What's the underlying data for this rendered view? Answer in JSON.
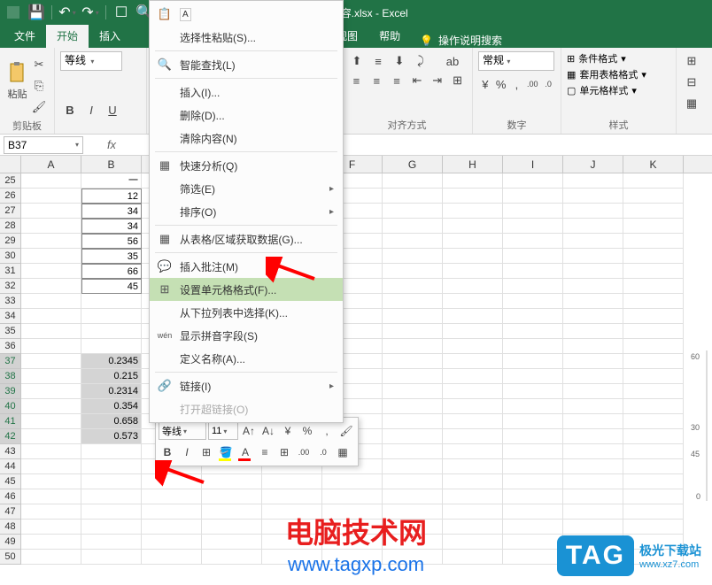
{
  "title": "Excel内容.xlsx - Excel",
  "tabs": {
    "file": "文件",
    "home": "开始",
    "insert": "插入",
    "view": "视图",
    "help": "帮助",
    "search": "操作说明搜索"
  },
  "ribbon": {
    "clipboard": {
      "paste": "粘贴",
      "label": "剪贴板"
    },
    "font": {
      "name": "等线",
      "bold": "B",
      "italic": "I",
      "underline": "U"
    },
    "align": {
      "label": "对齐方式"
    },
    "number": {
      "label": "数字",
      "general": "常规",
      "currency": "¥",
      "percent": "%",
      "comma": ",",
      "inc": ".00",
      "dec": ".0"
    },
    "styles": {
      "cond": "条件格式",
      "table": "套用表格格式",
      "cell": "单元格样式",
      "label": "样式"
    }
  },
  "namebox": "B37",
  "columns": [
    "A",
    "B",
    "",
    "",
    "",
    "F",
    "G",
    "H",
    "I",
    "J",
    "K"
  ],
  "rows": [
    {
      "n": 25,
      "b": "一"
    },
    {
      "n": 26,
      "b": "12",
      "bord": true
    },
    {
      "n": 27,
      "b": "34",
      "bord": true
    },
    {
      "n": 28,
      "b": "34",
      "bord": true
    },
    {
      "n": 29,
      "b": "56",
      "bord": true
    },
    {
      "n": 30,
      "b": "35",
      "bord": true
    },
    {
      "n": 31,
      "b": "66",
      "bord": true
    },
    {
      "n": 32,
      "b": "45",
      "bord": true
    },
    {
      "n": 33,
      "b": ""
    },
    {
      "n": 34,
      "b": ""
    },
    {
      "n": 35,
      "b": ""
    },
    {
      "n": 36,
      "b": ""
    },
    {
      "n": 37,
      "b": "0.2345",
      "sel": true
    },
    {
      "n": 38,
      "b": "0.215",
      "sel": true
    },
    {
      "n": 39,
      "b": "0.2314",
      "sel": true
    },
    {
      "n": 40,
      "b": "0.354",
      "sel": true
    },
    {
      "n": 41,
      "b": "0.658",
      "sel": true
    },
    {
      "n": 42,
      "b": "0.573",
      "sel": true
    },
    {
      "n": 43,
      "b": ""
    },
    {
      "n": 44,
      "b": ""
    },
    {
      "n": 45,
      "b": ""
    },
    {
      "n": 46,
      "b": ""
    },
    {
      "n": 47,
      "b": ""
    },
    {
      "n": 48,
      "b": ""
    },
    {
      "n": 49,
      "b": ""
    },
    {
      "n": 50,
      "b": ""
    }
  ],
  "ctx": {
    "paste_special": "选择性粘贴(S)...",
    "smart_lookup": "智能查找(L)",
    "insert": "插入(I)...",
    "delete": "删除(D)...",
    "clear": "清除内容(N)",
    "quick_analysis": "快速分析(Q)",
    "filter": "筛选(E)",
    "sort": "排序(O)",
    "from_table": "从表格/区域获取数据(G)...",
    "insert_comment": "插入批注(M)",
    "format_cells": "设置单元格格式(F)...",
    "dropdown": "从下拉列表中选择(K)...",
    "pinyin": "显示拼音字段(S)",
    "define_name": "定义名称(A)...",
    "link": "链接(I)",
    "open_link": "打开超链接(O)"
  },
  "mini": {
    "font": "等线",
    "size": "11"
  },
  "sparkline_values": [
    60,
    30,
    45,
    0
  ],
  "watermark": {
    "title": "电脑技术网",
    "url": "www.tagxp.com",
    "tag": "TAG",
    "tagtext": "极光下载站",
    "tagurl": "www.xz7.com"
  }
}
